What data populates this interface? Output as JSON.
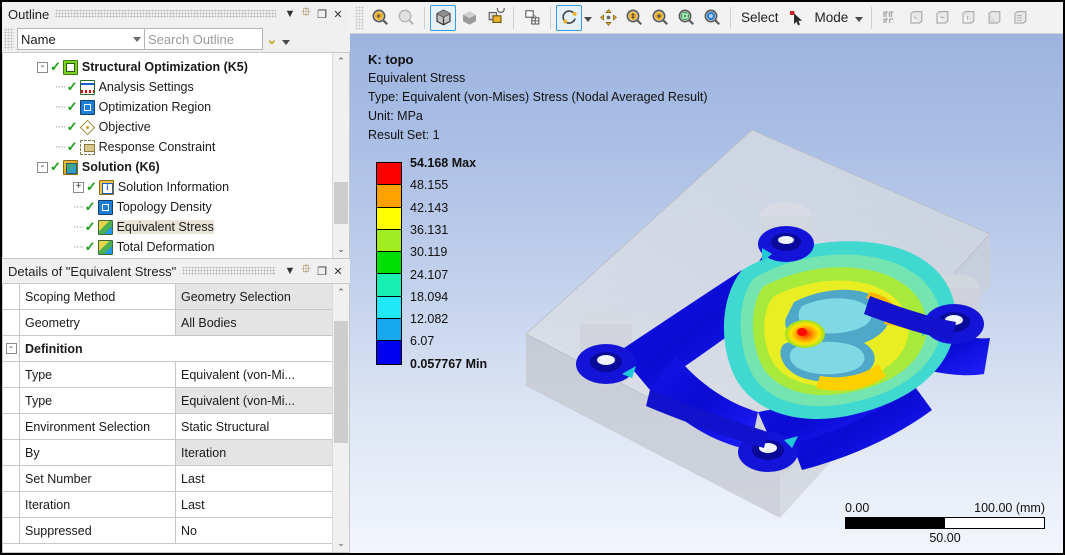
{
  "outline": {
    "title": "Outline",
    "window_buttons": [
      "dropdown",
      "pin",
      "maximize",
      "close"
    ],
    "filter": {
      "field_label": "Name",
      "search_placeholder": "Search Outline"
    },
    "tree": [
      {
        "label": "Structural Optimization (K5)",
        "icon": "optimization-icon",
        "depth": 1,
        "expander": "-",
        "bold": true,
        "checked": true,
        "selected": false
      },
      {
        "label": "Analysis Settings",
        "icon": "analysis-settings-icon",
        "depth": 2,
        "expander": "",
        "bold": false,
        "checked": true,
        "selected": false
      },
      {
        "label": "Optimization Region",
        "icon": "optimization-region-icon",
        "depth": 2,
        "expander": "",
        "bold": false,
        "checked": true,
        "selected": false
      },
      {
        "label": "Objective",
        "icon": "objective-icon",
        "depth": 2,
        "expander": "",
        "bold": false,
        "checked": true,
        "selected": false
      },
      {
        "label": "Response Constraint",
        "icon": "response-constraint-icon",
        "depth": 2,
        "expander": "",
        "bold": false,
        "checked": true,
        "selected": false
      },
      {
        "label": "Solution (K6)",
        "icon": "solution-icon",
        "depth": 1,
        "expander": "-",
        "bold": true,
        "checked": true,
        "selected": false
      },
      {
        "label": "Solution Information",
        "icon": "solution-information-icon",
        "depth": 3,
        "expander": "+",
        "bold": false,
        "checked": true,
        "selected": false
      },
      {
        "label": "Topology Density",
        "icon": "topology-density-icon",
        "depth": 3,
        "expander": "",
        "bold": false,
        "checked": true,
        "selected": false
      },
      {
        "label": "Equivalent Stress",
        "icon": "equivalent-stress-icon",
        "depth": 3,
        "expander": "",
        "bold": false,
        "checked": true,
        "selected": true
      },
      {
        "label": "Total Deformation",
        "icon": "total-deformation-icon",
        "depth": 3,
        "expander": "",
        "bold": false,
        "checked": true,
        "selected": false
      }
    ]
  },
  "details": {
    "title": "Details of \"Equivalent Stress\"",
    "rows": [
      {
        "key": "Scoping Method",
        "value": "Geometry Selection",
        "shaded": true,
        "header": false,
        "expander": ""
      },
      {
        "key": "Geometry",
        "value": "All Bodies",
        "shaded": true,
        "header": false,
        "expander": ""
      },
      {
        "key": "Definition",
        "value": "",
        "shaded": false,
        "header": true,
        "expander": "-"
      },
      {
        "key": "Type",
        "value": "Equivalent (von-Mi...",
        "shaded": false,
        "header": false,
        "expander": ""
      },
      {
        "key": "Type",
        "value": "Equivalent (von-Mi...",
        "shaded": true,
        "header": false,
        "expander": ""
      },
      {
        "key": "Environment Selection",
        "value": "Static Structural",
        "shaded": false,
        "header": false,
        "expander": ""
      },
      {
        "key": "By",
        "value": "Iteration",
        "shaded": true,
        "header": false,
        "expander": ""
      },
      {
        "key": "Set Number",
        "value": "Last",
        "shaded": false,
        "header": false,
        "expander": ""
      },
      {
        "key": "Iteration",
        "value": "Last",
        "shaded": false,
        "header": false,
        "expander": ""
      },
      {
        "key": "Suppressed",
        "value": "No",
        "shaded": false,
        "header": false,
        "expander": ""
      }
    ]
  },
  "toolbar": {
    "items": [
      {
        "name": "zoom-to-fit-icon",
        "type": "icon",
        "active": false,
        "disabled": false
      },
      {
        "name": "zoom-out-icon",
        "type": "icon",
        "active": false,
        "disabled": true
      },
      {
        "name": "shaded-exterior-edges-icon",
        "type": "icon",
        "active": true,
        "disabled": false
      },
      {
        "name": "shaded-exterior-icon",
        "type": "icon",
        "active": false,
        "disabled": false
      },
      {
        "name": "wireframe-icon",
        "type": "icon",
        "active": false,
        "disabled": false
      },
      {
        "name": "show-mesh-icon",
        "type": "icon",
        "active": false,
        "disabled": false
      },
      {
        "name": "rotate-icon",
        "type": "icon",
        "active": true,
        "disabled": false
      },
      {
        "name": "pan-icon",
        "type": "icon",
        "active": false,
        "disabled": false
      },
      {
        "name": "zoom-icon",
        "type": "icon",
        "active": false,
        "disabled": false
      },
      {
        "name": "box-zoom-icon",
        "type": "icon",
        "active": false,
        "disabled": false
      },
      {
        "name": "zoom-to-fit-2-icon",
        "type": "icon",
        "active": false,
        "disabled": false
      },
      {
        "name": "magnifier-icon",
        "type": "icon",
        "active": false,
        "disabled": false
      }
    ],
    "select_label": "Select",
    "mode_label": "Mode",
    "view_icons": [
      "named-selection-icon",
      "front-view-icon",
      "back-view-icon",
      "left-view-icon",
      "right-view-icon",
      "iso-view-icon"
    ]
  },
  "viewport": {
    "annotation": {
      "title": "K: topo",
      "result_name": "Equivalent Stress",
      "type_line": "Type: Equivalent (von-Mises) Stress (Nodal Averaged Result)",
      "unit_line": "Unit: MPa",
      "result_set_line": "Result Set: 1"
    },
    "legend": {
      "max_label": "54.168 Max",
      "min_label": "0.057767 Min",
      "ticks": [
        "48.155",
        "42.143",
        "36.131",
        "30.119",
        "24.107",
        "18.094",
        "12.082",
        "6.07"
      ],
      "colors": [
        "#fd0000",
        "#ffa200",
        "#ffff00",
        "#a0ee22",
        "#00e000",
        "#18f0b4",
        "#20e8f8",
        "#18a8f0",
        "#0000f0"
      ]
    },
    "scale": {
      "min": "0.00",
      "mid": "50.00",
      "max": "100.00",
      "unit": "(mm)"
    }
  },
  "chart_data": {
    "type": "heatmap",
    "title": "Equivalent Stress contour plot",
    "ylabel": "Equivalent (von-Mises) Stress",
    "unit": "MPa",
    "categories": [
      "0.057767",
      "6.07",
      "12.082",
      "18.094",
      "24.107",
      "30.119",
      "36.131",
      "42.143",
      "48.155",
      "54.168"
    ],
    "values": [
      0.057767,
      6.07,
      12.082,
      18.094,
      24.107,
      30.119,
      36.131,
      42.143,
      48.155,
      54.168
    ],
    "colors": [
      "#0000f0",
      "#18a8f0",
      "#20e8f8",
      "#18f0b4",
      "#00e000",
      "#a0ee22",
      "#ffff00",
      "#ffa200",
      "#fd0000"
    ],
    "ylim": [
      0.057767,
      54.168
    ],
    "legend_position": "left",
    "grid": false
  }
}
